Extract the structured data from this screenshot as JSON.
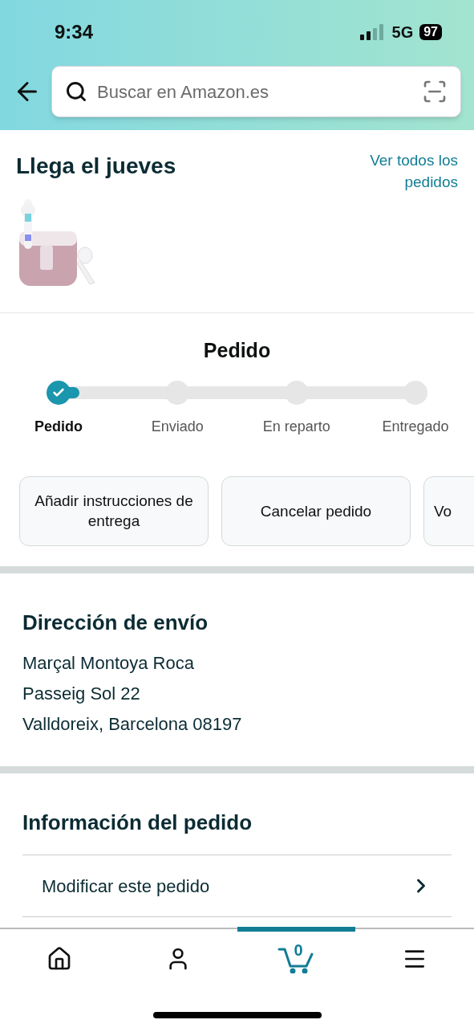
{
  "status_bar": {
    "time": "9:34",
    "network": "5G",
    "battery": "97"
  },
  "search": {
    "placeholder": "Buscar en Amazon.es"
  },
  "delivery": {
    "title": "Llega el jueves",
    "link": "Ver todos los pedidos"
  },
  "progress": {
    "title": "Pedido",
    "steps": [
      {
        "label": "Pedido",
        "done": true
      },
      {
        "label": "Enviado",
        "done": false
      },
      {
        "label": "En reparto",
        "done": false
      },
      {
        "label": "Entregado",
        "done": false
      }
    ]
  },
  "actions": [
    "Añadir instrucciones de entrega",
    "Cancelar pedido",
    "Vo"
  ],
  "shipping": {
    "title": "Dirección de envío",
    "lines": [
      "Marçal Montoya Roca",
      "Passeig Sol 22",
      "Valldoreix, Barcelona 08197"
    ]
  },
  "order_info": {
    "title": "Información del pedido",
    "items": [
      "Modificar este pedido"
    ]
  },
  "bottom_nav": [
    {
      "kind": "home",
      "selected": false
    },
    {
      "kind": "account",
      "selected": false
    },
    {
      "kind": "cart",
      "selected": true,
      "count": "0"
    },
    {
      "kind": "menu",
      "selected": false
    }
  ]
}
